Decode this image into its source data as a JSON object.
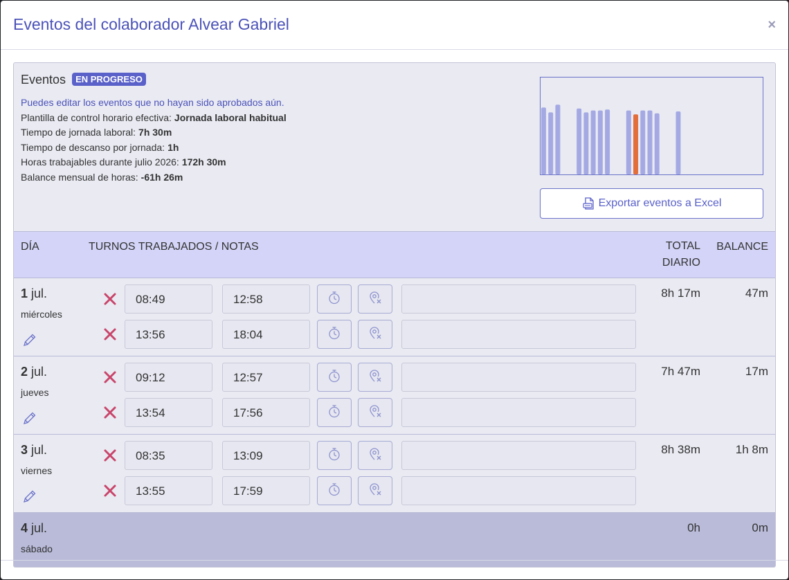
{
  "modal": {
    "title": "Eventos del colaborador Alvear Gabriel",
    "close": "×"
  },
  "summary": {
    "title": "Eventos",
    "badge": "EN PROGRESO",
    "hint": "Puedes editar los eventos que no hayan sido aprobados aún.",
    "lines": [
      {
        "label": "Plantilla de control horario efectiva:",
        "value": "Jornada laboral habitual"
      },
      {
        "label": "Tiempo de jornada laboral:",
        "value": "7h 30m"
      },
      {
        "label": "Tiempo de descanso por jornada:",
        "value": "1h"
      },
      {
        "label": "Horas trabajables durante julio 2026:",
        "value": "172h 30m"
      },
      {
        "label": "Balance mensual de horas:",
        "value": "-61h 26m"
      }
    ],
    "export_label": "Exportar eventos a Excel"
  },
  "mini_chart": {
    "colors": {
      "normal": "#a4a9e3",
      "highlight": "#e36d3b"
    },
    "bars": [
      {
        "v": 0.69,
        "h": false
      },
      {
        "v": 0.64,
        "h": false
      },
      {
        "v": 0.72,
        "h": false
      },
      null,
      null,
      {
        "v": 0.68,
        "h": false
      },
      {
        "v": 0.64,
        "h": false
      },
      {
        "v": 0.66,
        "h": false
      },
      {
        "v": 0.66,
        "h": false
      },
      {
        "v": 0.67,
        "h": false
      },
      null,
      null,
      {
        "v": 0.66,
        "h": false
      },
      {
        "v": 0.62,
        "h": true
      },
      {
        "v": 0.66,
        "h": false
      },
      {
        "v": 0.66,
        "h": false
      },
      {
        "v": 0.63,
        "h": false
      },
      null,
      null,
      {
        "v": 0.65,
        "h": false
      }
    ]
  },
  "table": {
    "headers": {
      "dia": "DÍA",
      "turnos": "TURNOS TRABAJADOS / NOTAS",
      "total": "TOTAL DIARIO",
      "balance": "BALANCE"
    },
    "days": [
      {
        "num": "1",
        "month": "jul.",
        "weekday": "miércoles",
        "total": "8h 17m",
        "balance": "47m",
        "shifts": [
          {
            "in": "08:49",
            "out": "12:58"
          },
          {
            "in": "13:56",
            "out": "18:04"
          }
        ]
      },
      {
        "num": "2",
        "month": "jul.",
        "weekday": "jueves",
        "total": "7h 47m",
        "balance": "17m",
        "shifts": [
          {
            "in": "09:12",
            "out": "12:57"
          },
          {
            "in": "13:54",
            "out": "17:56"
          }
        ]
      },
      {
        "num": "3",
        "month": "jul.",
        "weekday": "viernes",
        "total": "8h 38m",
        "balance": "1h 8m",
        "shifts": [
          {
            "in": "08:35",
            "out": "13:09"
          },
          {
            "in": "13:55",
            "out": "17:59"
          }
        ]
      },
      {
        "num": "4",
        "month": "jul.",
        "weekday": "sábado",
        "total": "0h",
        "balance": "0m",
        "shifts": []
      }
    ]
  }
}
